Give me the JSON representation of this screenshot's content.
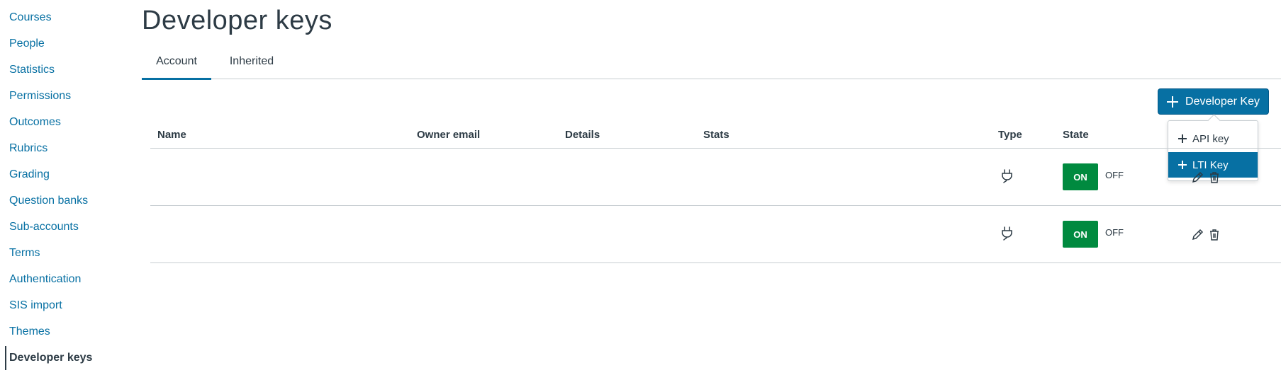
{
  "sidebar": {
    "items": [
      {
        "label": "Courses"
      },
      {
        "label": "People"
      },
      {
        "label": "Statistics"
      },
      {
        "label": "Permissions"
      },
      {
        "label": "Outcomes"
      },
      {
        "label": "Rubrics"
      },
      {
        "label": "Grading"
      },
      {
        "label": "Question banks"
      },
      {
        "label": "Sub-accounts"
      },
      {
        "label": "Terms"
      },
      {
        "label": "Authentication"
      },
      {
        "label": "SIS import"
      },
      {
        "label": "Themes"
      },
      {
        "label": "Developer keys"
      }
    ],
    "active": "Developer keys"
  },
  "page": {
    "title": "Developer keys"
  },
  "tabs": [
    {
      "label": "Account",
      "selected": true
    },
    {
      "label": "Inherited",
      "selected": false
    }
  ],
  "add_button": {
    "label": "Developer Key",
    "icon": "plus-icon"
  },
  "dropdown": {
    "items": [
      {
        "label": "API key",
        "icon": "plus-icon",
        "highlighted": false
      },
      {
        "label": "LTI Key",
        "icon": "plus-icon",
        "highlighted": true
      }
    ]
  },
  "table": {
    "headers": {
      "name": "Name",
      "owner_email": "Owner email",
      "details": "Details",
      "stats": "Stats",
      "type": "Type",
      "state": "State"
    },
    "rows": [
      {
        "type_icon": "lti-plug-icon",
        "state_on": "ON",
        "state_off": "OFF",
        "actions": [
          "pencil-icon",
          "trash-icon"
        ]
      },
      {
        "type_icon": "lti-plug-icon",
        "state_on": "ON",
        "state_off": "OFF",
        "actions": [
          "pencil-icon",
          "trash-icon"
        ]
      }
    ]
  },
  "colors": {
    "link": "#0770a3",
    "primary": "#0770a3",
    "on_state": "#008a3f",
    "text": "#2d3b45",
    "border": "#c7cdd1"
  }
}
